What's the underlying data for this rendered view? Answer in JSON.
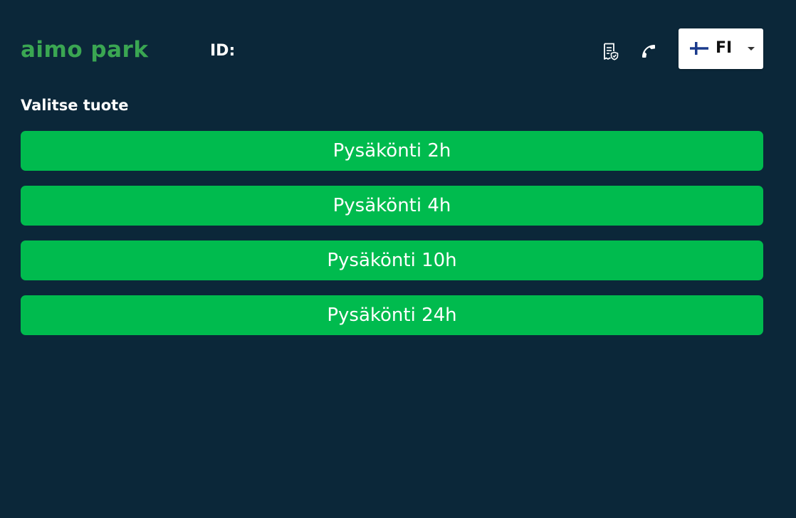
{
  "header": {
    "logo_text": "aimo park",
    "id_label": "ID:",
    "icons": {
      "receipt": "receipt-shield-icon",
      "phone": "phone-icon"
    },
    "language": {
      "flag": "finland-flag-icon",
      "code": "FI"
    }
  },
  "main": {
    "section_title": "Valitse tuote",
    "products": [
      {
        "label": "Pysäkönti 2h"
      },
      {
        "label": "Pysäkönti 4h"
      },
      {
        "label": "Pysäkönti 10h"
      },
      {
        "label": "Pysäkönti 24h"
      }
    ]
  },
  "colors": {
    "background": "#0b2739",
    "logo": "#3aa652",
    "button": "#00bb4e",
    "button_text": "#ffffff",
    "flag_blue": "#1a3a8c"
  }
}
